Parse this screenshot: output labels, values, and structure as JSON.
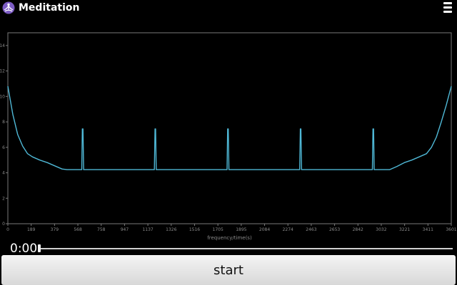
{
  "app": {
    "title": "Meditation",
    "icon": "meditation-figure-icon",
    "menu_icon": "hamburger-menu-icon"
  },
  "chart_data": {
    "type": "line",
    "xlabel": "frequency/time(s)",
    "ylabel": "",
    "xlim": [
      0,
      3601
    ],
    "ylim": [
      0,
      15
    ],
    "x_ticks": [
      "0",
      "189",
      "379",
      "568",
      "758",
      "947",
      "1137",
      "1326",
      "1516",
      "1705",
      "1895",
      "2084",
      "2274",
      "2463",
      "2653",
      "2842",
      "3032",
      "3221",
      "3411",
      "3601"
    ],
    "y_ticks": [
      "0",
      "2",
      "4",
      "6",
      "8",
      "10",
      "12",
      "14"
    ],
    "grid": false,
    "series": [
      {
        "color": "#4fb8d6",
        "x": [
          0,
          40,
          80,
          120,
          160,
          200,
          260,
          320,
          380,
          440,
          480,
          600,
          605,
          610,
          615,
          620,
          1190,
          1195,
          1200,
          1205,
          1210,
          1780,
          1785,
          1790,
          1795,
          1800,
          2370,
          2375,
          2380,
          2385,
          2390,
          2960,
          2965,
          2970,
          2975,
          2980,
          3100,
          3160,
          3220,
          3280,
          3340,
          3400,
          3440,
          3480,
          3520,
          3560,
          3601
        ],
        "y": [
          10.8,
          8.6,
          7.0,
          6.1,
          5.5,
          5.25,
          5.0,
          4.8,
          4.55,
          4.3,
          4.25,
          4.25,
          7.45,
          7.45,
          4.25,
          4.25,
          4.25,
          7.45,
          7.45,
          4.25,
          4.25,
          4.25,
          7.45,
          7.45,
          4.25,
          4.25,
          4.25,
          7.45,
          7.45,
          4.25,
          4.25,
          4.25,
          7.45,
          7.45,
          4.25,
          4.25,
          4.25,
          4.5,
          4.8,
          5.0,
          5.25,
          5.5,
          6.0,
          6.8,
          8.0,
          9.3,
          10.8
        ]
      }
    ]
  },
  "player": {
    "time": "0:00",
    "progress": 0.0
  },
  "actions": {
    "start_label": "start"
  }
}
